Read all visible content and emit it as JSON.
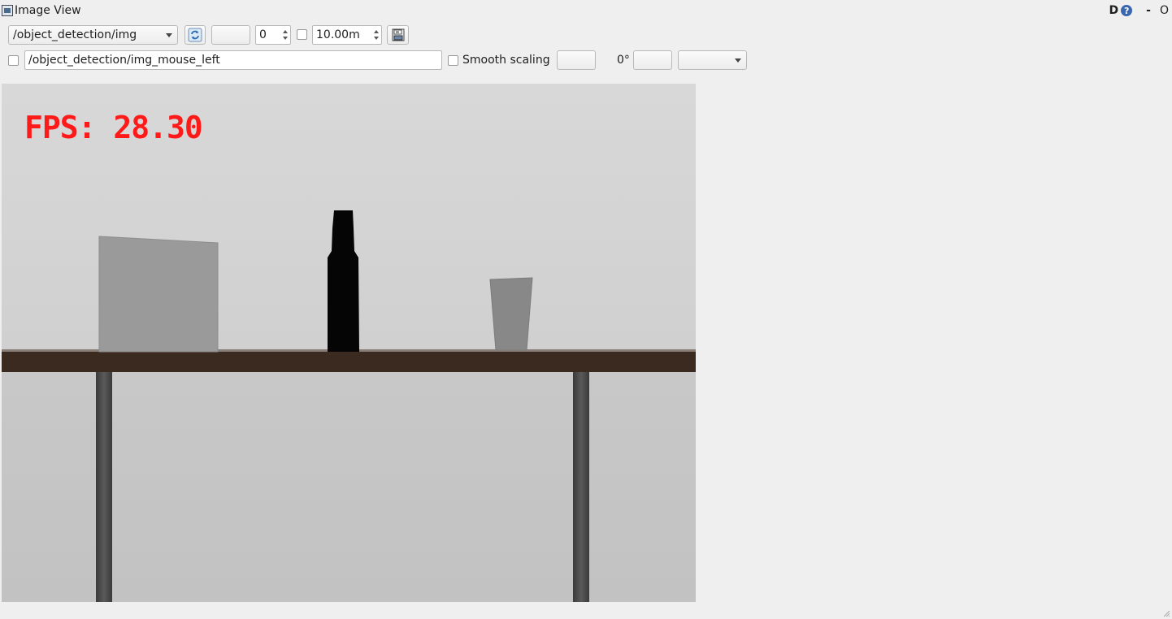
{
  "window": {
    "title": "Image View",
    "ctrl_d": "D",
    "ctrl_help": "?",
    "ctrl_min": "-",
    "ctrl_close": "O"
  },
  "toolbar": {
    "topic": "/object_detection/img",
    "blank_field": "",
    "spin_value": "0",
    "max_range": "10.00m",
    "icons": [
      "refresh-icon",
      "save-image-icon"
    ]
  },
  "row2": {
    "mouse_topic": "/object_detection/img_mouse_left",
    "smooth_scaling_label": "Smooth scaling",
    "smooth_scaling_checked": false,
    "rotation": "0°",
    "rotation_field": "",
    "dropdown_value": ""
  },
  "image": {
    "fps_text": "FPS: 28.30",
    "fps_color": "#ff1a1a",
    "objects": [
      "box",
      "bottle",
      "cup",
      "table"
    ]
  }
}
